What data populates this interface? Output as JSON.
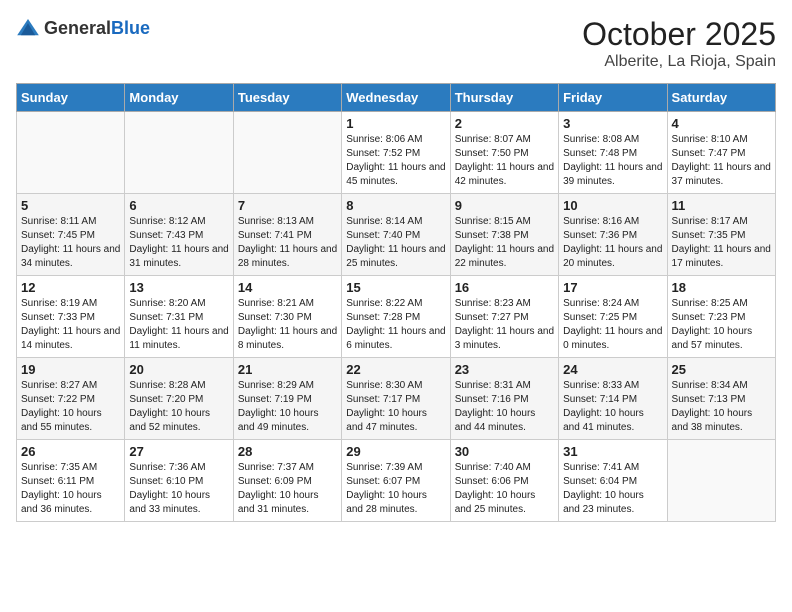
{
  "header": {
    "logo_general": "General",
    "logo_blue": "Blue",
    "month": "October 2025",
    "location": "Alberite, La Rioja, Spain"
  },
  "weekdays": [
    "Sunday",
    "Monday",
    "Tuesday",
    "Wednesday",
    "Thursday",
    "Friday",
    "Saturday"
  ],
  "weeks": [
    [
      {
        "day": "",
        "info": ""
      },
      {
        "day": "",
        "info": ""
      },
      {
        "day": "",
        "info": ""
      },
      {
        "day": "1",
        "info": "Sunrise: 8:06 AM\nSunset: 7:52 PM\nDaylight: 11 hours and 45 minutes."
      },
      {
        "day": "2",
        "info": "Sunrise: 8:07 AM\nSunset: 7:50 PM\nDaylight: 11 hours and 42 minutes."
      },
      {
        "day": "3",
        "info": "Sunrise: 8:08 AM\nSunset: 7:48 PM\nDaylight: 11 hours and 39 minutes."
      },
      {
        "day": "4",
        "info": "Sunrise: 8:10 AM\nSunset: 7:47 PM\nDaylight: 11 hours and 37 minutes."
      }
    ],
    [
      {
        "day": "5",
        "info": "Sunrise: 8:11 AM\nSunset: 7:45 PM\nDaylight: 11 hours and 34 minutes."
      },
      {
        "day": "6",
        "info": "Sunrise: 8:12 AM\nSunset: 7:43 PM\nDaylight: 11 hours and 31 minutes."
      },
      {
        "day": "7",
        "info": "Sunrise: 8:13 AM\nSunset: 7:41 PM\nDaylight: 11 hours and 28 minutes."
      },
      {
        "day": "8",
        "info": "Sunrise: 8:14 AM\nSunset: 7:40 PM\nDaylight: 11 hours and 25 minutes."
      },
      {
        "day": "9",
        "info": "Sunrise: 8:15 AM\nSunset: 7:38 PM\nDaylight: 11 hours and 22 minutes."
      },
      {
        "day": "10",
        "info": "Sunrise: 8:16 AM\nSunset: 7:36 PM\nDaylight: 11 hours and 20 minutes."
      },
      {
        "day": "11",
        "info": "Sunrise: 8:17 AM\nSunset: 7:35 PM\nDaylight: 11 hours and 17 minutes."
      }
    ],
    [
      {
        "day": "12",
        "info": "Sunrise: 8:19 AM\nSunset: 7:33 PM\nDaylight: 11 hours and 14 minutes."
      },
      {
        "day": "13",
        "info": "Sunrise: 8:20 AM\nSunset: 7:31 PM\nDaylight: 11 hours and 11 minutes."
      },
      {
        "day": "14",
        "info": "Sunrise: 8:21 AM\nSunset: 7:30 PM\nDaylight: 11 hours and 8 minutes."
      },
      {
        "day": "15",
        "info": "Sunrise: 8:22 AM\nSunset: 7:28 PM\nDaylight: 11 hours and 6 minutes."
      },
      {
        "day": "16",
        "info": "Sunrise: 8:23 AM\nSunset: 7:27 PM\nDaylight: 11 hours and 3 minutes."
      },
      {
        "day": "17",
        "info": "Sunrise: 8:24 AM\nSunset: 7:25 PM\nDaylight: 11 hours and 0 minutes."
      },
      {
        "day": "18",
        "info": "Sunrise: 8:25 AM\nSunset: 7:23 PM\nDaylight: 10 hours and 57 minutes."
      }
    ],
    [
      {
        "day": "19",
        "info": "Sunrise: 8:27 AM\nSunset: 7:22 PM\nDaylight: 10 hours and 55 minutes."
      },
      {
        "day": "20",
        "info": "Sunrise: 8:28 AM\nSunset: 7:20 PM\nDaylight: 10 hours and 52 minutes."
      },
      {
        "day": "21",
        "info": "Sunrise: 8:29 AM\nSunset: 7:19 PM\nDaylight: 10 hours and 49 minutes."
      },
      {
        "day": "22",
        "info": "Sunrise: 8:30 AM\nSunset: 7:17 PM\nDaylight: 10 hours and 47 minutes."
      },
      {
        "day": "23",
        "info": "Sunrise: 8:31 AM\nSunset: 7:16 PM\nDaylight: 10 hours and 44 minutes."
      },
      {
        "day": "24",
        "info": "Sunrise: 8:33 AM\nSunset: 7:14 PM\nDaylight: 10 hours and 41 minutes."
      },
      {
        "day": "25",
        "info": "Sunrise: 8:34 AM\nSunset: 7:13 PM\nDaylight: 10 hours and 38 minutes."
      }
    ],
    [
      {
        "day": "26",
        "info": "Sunrise: 7:35 AM\nSunset: 6:11 PM\nDaylight: 10 hours and 36 minutes."
      },
      {
        "day": "27",
        "info": "Sunrise: 7:36 AM\nSunset: 6:10 PM\nDaylight: 10 hours and 33 minutes."
      },
      {
        "day": "28",
        "info": "Sunrise: 7:37 AM\nSunset: 6:09 PM\nDaylight: 10 hours and 31 minutes."
      },
      {
        "day": "29",
        "info": "Sunrise: 7:39 AM\nSunset: 6:07 PM\nDaylight: 10 hours and 28 minutes."
      },
      {
        "day": "30",
        "info": "Sunrise: 7:40 AM\nSunset: 6:06 PM\nDaylight: 10 hours and 25 minutes."
      },
      {
        "day": "31",
        "info": "Sunrise: 7:41 AM\nSunset: 6:04 PM\nDaylight: 10 hours and 23 minutes."
      },
      {
        "day": "",
        "info": ""
      }
    ]
  ]
}
